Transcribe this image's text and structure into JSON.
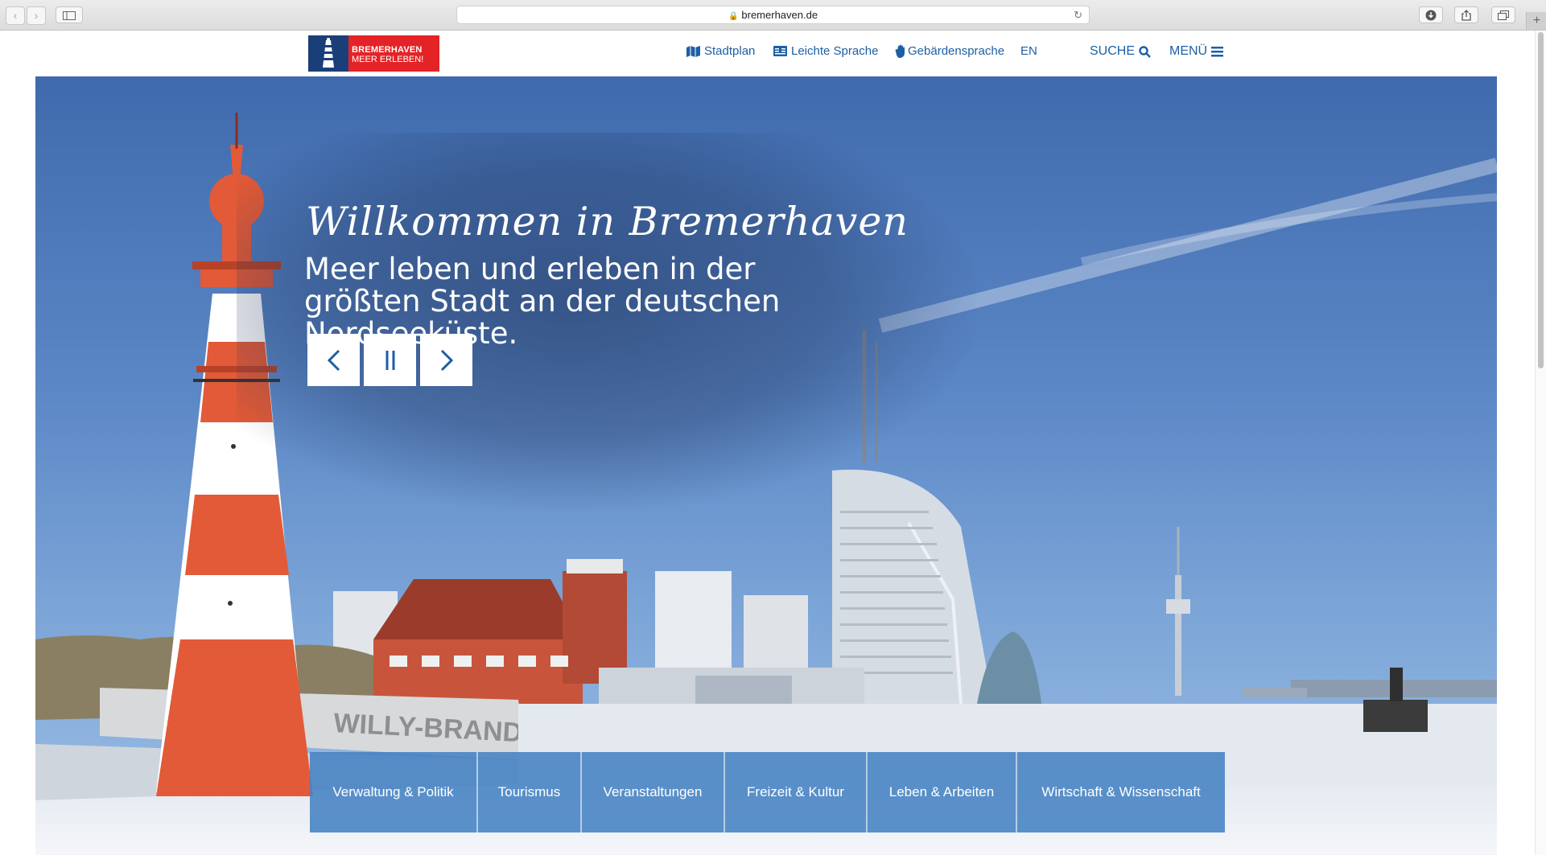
{
  "browser": {
    "url": "bremerhaven.de",
    "back_icon": "‹",
    "forward_icon": "›",
    "new_tab_symbol": "+"
  },
  "logo": {
    "line1": "BREMERHAVEN",
    "line2": "MEER ERLEBEN!"
  },
  "topnav": {
    "stadtplan": "Stadtplan",
    "leichte_sprache": "Leichte Sprache",
    "gebaerdensprache": "Gebärdensprache",
    "language": "EN",
    "search": "SUCHE",
    "menu": "MENÜ"
  },
  "hero": {
    "title": "Willkommen in Bremerhaven",
    "subtitle": "Meer leben und erleben in der größten Stadt an der deutschen Nordseeküste.",
    "square_sign": "WILLY-BRANDT-PLATZ"
  },
  "categories": [
    "Verwaltung & Politik",
    "Tourismus",
    "Veranstaltungen",
    "Freizeit & Kultur",
    "Leben & Arbeiten",
    "Wirtschaft & Wissenschaft"
  ],
  "colors": {
    "brand_blue": "#1d5fa3",
    "brand_red": "#e42326",
    "logo_blue": "#1a3f78"
  }
}
